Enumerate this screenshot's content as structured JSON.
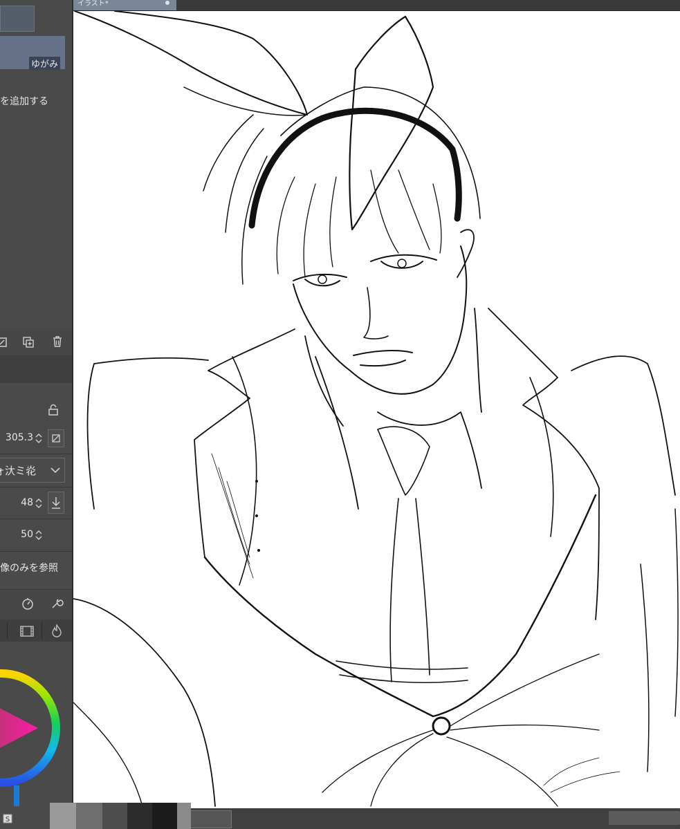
{
  "tab": {
    "title": "イラスト*"
  },
  "sub_tool": {
    "selected_label": "ゆがみ",
    "add_label": "を追加する"
  },
  "properties": {
    "size_value": "305.3",
    "brush_name": "ォ汏ミ炛",
    "hardness_value": "48",
    "density_value": "50",
    "reference_label": "像のみを参照"
  },
  "colors": {
    "canvas": "#ffffff",
    "panel": "#4a4a4a",
    "selection": "#67718a"
  },
  "icons": [
    "new-layer-icon",
    "copy-icon",
    "trash-icon",
    "lock-icon",
    "reset-icon",
    "download-icon",
    "dial-icon",
    "wrench-icon",
    "film-icon",
    "fire-icon",
    "color-wheel-icon"
  ]
}
